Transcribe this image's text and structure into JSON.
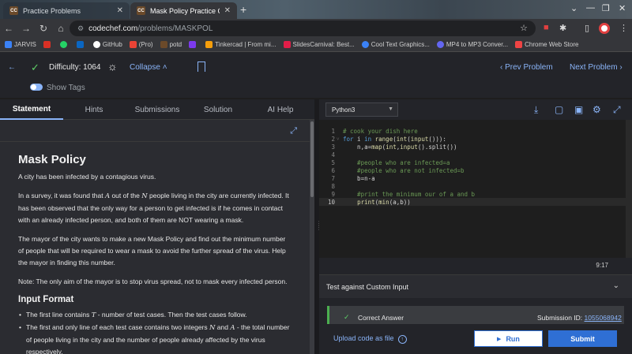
{
  "browser": {
    "tabs": [
      {
        "favicon": "CC",
        "label": "Practice Problems",
        "active": false
      },
      {
        "favicon": "CC",
        "label": "Mask Policy Practice Coding Pr",
        "active": true
      }
    ],
    "new_tab": "+",
    "url_host": "codechef.com",
    "url_path": "/problems/MASKPOL",
    "bookmarks": [
      {
        "label": "JARVIS",
        "color": "#3b82f6"
      },
      {
        "label": "",
        "color": "#d93025"
      },
      {
        "label": "",
        "color": "#25d366"
      },
      {
        "label": "",
        "color": "#0a66c2"
      },
      {
        "label": "GitHub",
        "color": "#ffffff"
      },
      {
        "label": "(Pro)",
        "color": "#ea4335"
      },
      {
        "label": "potd",
        "color": "#6b4a2a"
      },
      {
        "label": "",
        "color": "#7c3aed"
      },
      {
        "label": "Tinkercad | From mi...",
        "color": "#f59e0b"
      },
      {
        "label": "SlidesCarnival: Best...",
        "color": "#e11d48"
      },
      {
        "label": "Cool Text Graphics...",
        "color": "#3b82f6"
      },
      {
        "label": "MP4 to MP3 Conver...",
        "color": "#6366f1"
      },
      {
        "label": "Chrome Web Store",
        "color": "#ef4444"
      }
    ]
  },
  "problem_bar": {
    "difficulty": "Difficulty: 1064",
    "collapse": "Collapse",
    "prev": "Prev Problem",
    "next": "Next Problem",
    "show_tags": "Show Tags"
  },
  "left_tabs": [
    "Statement",
    "Hints",
    "Submissions",
    "Solution",
    "AI Help"
  ],
  "statement": {
    "title": "Mask Policy",
    "intro": "A city has been infected by a contagious virus.",
    "p1_a": "In a survey, it was found that ",
    "p1_var_a": "A",
    "p1_b": " out of the ",
    "p1_var_n": "N",
    "p1_c": " people living in the city are currently infected. It has been observed that the only way for a person to get infected is if he comes in contact with an already infected person, and both of them are NOT wearing a mask.",
    "p2": "The mayor of the city wants to make a new Mask Policy and find out the minimum number of people that will be required to wear a mask to avoid the further spread of the virus. Help the mayor in finding this number.",
    "p3": "Note: The only aim of the mayor is to stop virus spread, not to mask every infected person.",
    "input_heading": "Input Format",
    "li1_a": "The first line contains ",
    "li1_var": "T",
    "li1_b": " - number of test cases. Then the test cases follow.",
    "li2_a": "The first and only line of each test case contains two integers ",
    "li2_var_n": "N",
    "li2_and": " and ",
    "li2_var_a": "A",
    "li2_b": " - the total number of people living in the city and the number of people already affected by the virus respectively."
  },
  "editor": {
    "language": "Python3",
    "cursor_pos": "9:17",
    "lines": [
      {
        "n": "1",
        "fold": "",
        "code": "# cook your dish here"
      },
      {
        "n": "2",
        "fold": "˅",
        "code": "for i in range(int(input())):"
      },
      {
        "n": "3",
        "fold": "",
        "code": "    n,a=map(int,input().split())"
      },
      {
        "n": "4",
        "fold": "",
        "code": ""
      },
      {
        "n": "5",
        "fold": "",
        "code": "    #people who are infected=a"
      },
      {
        "n": "6",
        "fold": "",
        "code": "    #people who are not infected=b"
      },
      {
        "n": "7",
        "fold": "",
        "code": "    b=n-a"
      },
      {
        "n": "8",
        "fold": "",
        "code": ""
      },
      {
        "n": "9",
        "fold": "",
        "code": "    #print the minimum our of a and b"
      },
      {
        "n": "10",
        "fold": "",
        "code": "    print(min(a,b))"
      }
    ]
  },
  "custom_input": {
    "label": "Test against Custom Input"
  },
  "result": {
    "status": "Correct Answer",
    "submission_label": "Submission ID: ",
    "submission_id": "1055068942"
  },
  "actions": {
    "upload": "Upload code as file",
    "run": "Run",
    "submit": "Submit"
  }
}
